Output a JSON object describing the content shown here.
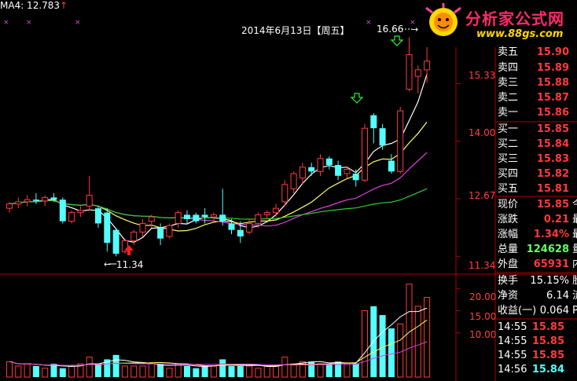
{
  "colors": {
    "up": "#ff3b3b",
    "down": "#54ffff",
    "ma_white": "#ffffff",
    "ma_yellow": "#ffff66",
    "ma_magenta": "#e040e0",
    "ma_green": "#33cc33",
    "grid": "#aa0000",
    "panel_price": "#ff3b3b",
    "panel_green": "#66ff66"
  },
  "header": {
    "ma_label": "MA4: 12.783",
    "ma_arrow": "↑",
    "date_label": "2014年6月13日【周五】",
    "high_label": "16.66",
    "low_label": "11.34"
  },
  "logo": {
    "title": "分析家公式网",
    "url": "www.88gs.com"
  },
  "price_axis": [
    "15.33",
    "14.00",
    "12.67",
    "11.34"
  ],
  "volume_axis": [
    "20.00",
    "15.00",
    "10.00"
  ],
  "order_book": [
    {
      "label": "卖五",
      "price": "15.90"
    },
    {
      "label": "卖四",
      "price": "15.89"
    },
    {
      "label": "卖三",
      "price": "15.88"
    },
    {
      "label": "卖二",
      "price": "15.87"
    },
    {
      "label": "卖一",
      "price": "15.86"
    },
    {
      "label": "买一",
      "price": "15.85"
    },
    {
      "label": "买二",
      "price": "15.84"
    },
    {
      "label": "买三",
      "price": "15.83"
    },
    {
      "label": "买四",
      "price": "15.82"
    },
    {
      "label": "买五",
      "price": "15.81"
    }
  ],
  "quote": [
    {
      "label": "现价",
      "value": "15.85",
      "ext": "今"
    },
    {
      "label": "涨跌",
      "value": "0.21",
      "ext": "最"
    },
    {
      "label": "涨幅",
      "value": "1.34%",
      "ext": "最"
    },
    {
      "label": "总量",
      "value": "124628",
      "ext": "量"
    },
    {
      "label": "外盘",
      "value": "65931",
      "ext": "内"
    }
  ],
  "stats": [
    {
      "label": "换手",
      "value": "15.15%",
      "ext": "股"
    },
    {
      "label": "净资",
      "value": "6.14",
      "ext": "流"
    },
    {
      "label": "收益(一)",
      "value": "0.064",
      "ext": "P"
    }
  ],
  "ticks": [
    {
      "time": "14:55",
      "price": "15.85"
    },
    {
      "time": "14:55",
      "price": "15.85"
    },
    {
      "time": "14:55",
      "price": "15.85"
    },
    {
      "time": "14:56",
      "price": "15.84"
    }
  ],
  "chart_data": {
    "type": "candlestick",
    "price_range": [
      11.0,
      16.9
    ],
    "volume_range": [
      0,
      22
    ],
    "candles": [
      {
        "o": 12.45,
        "h": 12.6,
        "l": 12.35,
        "c": 12.55
      },
      {
        "o": 12.55,
        "h": 12.7,
        "l": 12.45,
        "c": 12.6
      },
      {
        "o": 12.6,
        "h": 12.75,
        "l": 12.5,
        "c": 12.65
      },
      {
        "o": 12.65,
        "h": 12.8,
        "l": 12.55,
        "c": 12.62
      },
      {
        "o": 12.62,
        "h": 12.75,
        "l": 12.5,
        "c": 12.7
      },
      {
        "o": 12.7,
        "h": 12.8,
        "l": 12.6,
        "c": 12.65
      },
      {
        "o": 12.65,
        "h": 12.7,
        "l": 12.1,
        "c": 12.15
      },
      {
        "o": 12.15,
        "h": 12.4,
        "l": 12.1,
        "c": 12.35
      },
      {
        "o": 12.35,
        "h": 12.5,
        "l": 12.25,
        "c": 12.4
      },
      {
        "o": 12.5,
        "h": 13.2,
        "l": 12.4,
        "c": 12.75
      },
      {
        "o": 12.45,
        "h": 12.5,
        "l": 12.0,
        "c": 12.1
      },
      {
        "o": 12.35,
        "h": 12.45,
        "l": 11.45,
        "c": 11.65
      },
      {
        "o": 11.95,
        "h": 12.0,
        "l": 11.34,
        "c": 11.4
      },
      {
        "o": 11.45,
        "h": 11.75,
        "l": 11.4,
        "c": 11.7
      },
      {
        "o": 11.7,
        "h": 11.95,
        "l": 11.6,
        "c": 11.9
      },
      {
        "o": 11.9,
        "h": 12.2,
        "l": 11.8,
        "c": 12.1
      },
      {
        "o": 12.15,
        "h": 12.3,
        "l": 12.0,
        "c": 12.25
      },
      {
        "o": 12.0,
        "h": 12.1,
        "l": 11.6,
        "c": 11.75
      },
      {
        "o": 11.8,
        "h": 12.1,
        "l": 11.75,
        "c": 12.05
      },
      {
        "o": 12.1,
        "h": 12.4,
        "l": 12.0,
        "c": 12.35
      },
      {
        "o": 12.3,
        "h": 12.4,
        "l": 12.1,
        "c": 12.2
      },
      {
        "o": 12.3,
        "h": 12.35,
        "l": 12.1,
        "c": 12.15
      },
      {
        "o": 12.3,
        "h": 12.45,
        "l": 12.1,
        "c": 12.25
      },
      {
        "o": 12.25,
        "h": 12.35,
        "l": 12.15,
        "c": 12.3
      },
      {
        "o": 12.3,
        "h": 12.9,
        "l": 12.05,
        "c": 12.15
      },
      {
        "o": 12.1,
        "h": 12.2,
        "l": 11.85,
        "c": 11.95
      },
      {
        "o": 11.95,
        "h": 12.15,
        "l": 11.65,
        "c": 11.8
      },
      {
        "o": 11.9,
        "h": 12.2,
        "l": 11.85,
        "c": 12.1
      },
      {
        "o": 12.1,
        "h": 12.35,
        "l": 12.0,
        "c": 12.3
      },
      {
        "o": 12.3,
        "h": 12.4,
        "l": 12.2,
        "c": 12.35
      },
      {
        "o": 12.35,
        "h": 12.55,
        "l": 12.25,
        "c": 12.45
      },
      {
        "o": 12.6,
        "h": 13.1,
        "l": 12.5,
        "c": 13.0
      },
      {
        "o": 12.9,
        "h": 13.3,
        "l": 12.8,
        "c": 13.25
      },
      {
        "o": 13.15,
        "h": 13.5,
        "l": 13.0,
        "c": 13.4
      },
      {
        "o": 13.4,
        "h": 13.5,
        "l": 13.2,
        "c": 13.3
      },
      {
        "o": 13.3,
        "h": 13.7,
        "l": 13.2,
        "c": 13.6
      },
      {
        "o": 13.6,
        "h": 13.65,
        "l": 13.35,
        "c": 13.45
      },
      {
        "o": 13.45,
        "h": 13.55,
        "l": 13.1,
        "c": 13.2
      },
      {
        "o": 13.25,
        "h": 13.4,
        "l": 13.15,
        "c": 13.35
      },
      {
        "o": 13.25,
        "h": 13.35,
        "l": 12.95,
        "c": 13.1
      },
      {
        "o": 13.1,
        "h": 14.4,
        "l": 13.05,
        "c": 14.3
      },
      {
        "o": 14.6,
        "h": 14.65,
        "l": 13.95,
        "c": 14.3
      },
      {
        "o": 14.3,
        "h": 14.4,
        "l": 13.8,
        "c": 13.9
      },
      {
        "o": 13.55,
        "h": 13.7,
        "l": 13.25,
        "c": 13.3
      },
      {
        "o": 13.3,
        "h": 14.8,
        "l": 13.25,
        "c": 14.7
      },
      {
        "o": 15.2,
        "h": 16.4,
        "l": 15.15,
        "c": 16.0
      },
      {
        "o": 15.5,
        "h": 15.75,
        "l": 15.1,
        "c": 15.65
      },
      {
        "o": 15.65,
        "h": 16.66,
        "l": 15.35,
        "c": 15.85
      }
    ],
    "volumes": [
      3.5,
      2.5,
      3,
      2.5,
      2,
      3,
      2,
      2.5,
      3,
      4.5,
      3,
      4,
      5,
      2.5,
      2.5,
      2.5,
      3,
      3,
      2,
      3,
      2.5,
      2,
      2.5,
      2.5,
      4,
      2.5,
      2.5,
      2.5,
      2,
      2.5,
      2.5,
      4.5,
      3,
      3.5,
      3.5,
      3,
      3,
      3.5,
      3,
      3,
      15,
      16,
      14,
      11,
      12,
      21,
      16,
      18
    ]
  }
}
